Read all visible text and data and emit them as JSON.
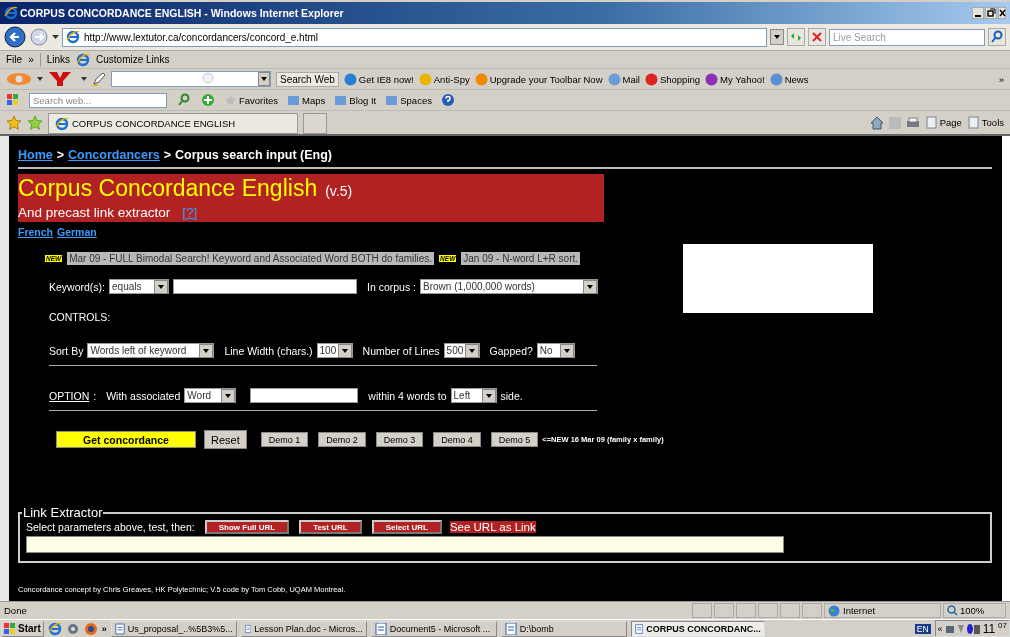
{
  "window": {
    "title": "CORPUS CONCORDANCE ENGLISH - Windows Internet Explorer"
  },
  "address_bar": {
    "url": "http://www.lextutor.ca/concordancers/concord_e.html",
    "search_placeholder": "Live Search"
  },
  "menu_bar": {
    "items": [
      "File",
      "»"
    ],
    "links_label": "Links",
    "links": [
      "Customize Links"
    ]
  },
  "yahoo_toolbar": {
    "search_button": "Search Web",
    "items": [
      "Get IE8 now!",
      "Anti-Spy",
      "Upgrade your Toolbar Now",
      "Mail",
      "Shopping",
      "My Yahoo!",
      "News"
    ],
    "overflow": "»"
  },
  "second_toolbar": {
    "search_placeholder": "Search web...",
    "items": [
      "Favorites",
      "Maps",
      "Blog It",
      "Spaces"
    ]
  },
  "tabs": [
    {
      "label": "CORPUS CONCORDANCE ENGLISH",
      "selected": true
    }
  ],
  "command_bar": [
    "Page",
    "Tools"
  ],
  "page": {
    "breadcrumb": [
      {
        "text": "Home",
        "kind": "link"
      },
      {
        "text": ">",
        "kind": "sep"
      },
      {
        "text": "Concordancers",
        "kind": "link"
      },
      {
        "text": ">",
        "kind": "sep"
      },
      {
        "text": "Corpus search input (Eng)",
        "kind": "current"
      }
    ],
    "banner": {
      "title": "Corpus Concordance English",
      "version": "(v.5)",
      "subtitle": "And precast link extractor",
      "help": "[?]"
    },
    "languages": [
      "French",
      "German"
    ],
    "news": [
      {
        "badge": "NEW",
        "text": "Mar 09 - FULL Bimodal Search! Keyword and Associated Word BOTH do families."
      },
      {
        "badge": "NEW",
        "text": "Jan 09 - N-word L+R sort."
      }
    ],
    "keyword": {
      "label": "Keyword(s):",
      "mode": "equals",
      "corpus_label": "In corpus :",
      "corpus": "Brown (1,000,000 words)"
    },
    "controls_label": "CONTROLS:",
    "controls": [
      {
        "label": "Sort By",
        "value": "Words left of keyword"
      },
      {
        "label": "Line Width (chars.)",
        "value": "100"
      },
      {
        "label": "Number of Lines",
        "value": "500"
      },
      {
        "label": "Gapped?",
        "value": "No"
      }
    ],
    "option": {
      "label": "OPTION",
      "colon": ":",
      "with_label": "With associated",
      "with_value": "Word",
      "within_label": "within 4 words to",
      "side_value": "Left",
      "side_label": "side."
    },
    "buttons": {
      "submit": "Get concordance",
      "reset": "Reset",
      "demos": [
        "Demo 1",
        "Demo 2",
        "Demo 3",
        "Demo 4",
        "Demo 5"
      ],
      "note": "<=NEW 16 Mar 09 (family x family)"
    },
    "link_extractor": {
      "legend": "Link Extractor",
      "prompt": "Select parameters above, test, then:",
      "buttons": [
        "Show Full URL",
        "Test URL",
        "Select URL"
      ],
      "link": "See URL as Link"
    },
    "footer": "Concordance concept by Chris Greaves, HK Polytechnic; V.5 code by Tom Cobb, UQAM Montreal."
  },
  "status_bar": {
    "text": "Done",
    "zone": "Internet",
    "zoom": "100%"
  },
  "taskbar": {
    "start": "Start",
    "quick_launch_more": "»",
    "items": [
      {
        "label": "Us_proposal_..%5B3%5...",
        "selected": false
      },
      {
        "label": "Lesson Plan.doc - Micros...",
        "selected": false
      },
      {
        "label": "Document5 - Microsoft ...",
        "selected": false
      },
      {
        "label": "D:\\bomb",
        "selected": false
      },
      {
        "label": "CORPUS CONCORDANC...",
        "selected": true
      }
    ],
    "language": "EN",
    "tray_more": "«",
    "clock_hour": "11",
    "clock_minute": "07"
  }
}
